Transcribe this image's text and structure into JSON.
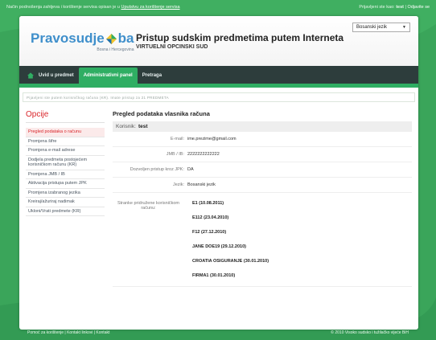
{
  "topbar": {
    "left_text": "Način podnošenja zahtjeva i korištenje servisa opisan je u",
    "left_link": "Uputstvu za korištenje servisa",
    "right_text": "Prijavljeni ste kao:",
    "right_user": "test",
    "right_sep": "|",
    "logout": "Odjavite se"
  },
  "header": {
    "logo_part1": "Pravosudje",
    "logo_part2": "ba",
    "logo_sub": "Bosna i Hercegovina",
    "title": "Pristup sudskim predmetima putem Interneta",
    "subtitle": "VIRTUELNI OPCINSKI SUD",
    "language": {
      "selected": "Bosanski jezik"
    }
  },
  "nav": {
    "tabs": [
      {
        "label": "Uvid u predmet"
      },
      {
        "label": "Administrativni panel"
      },
      {
        "label": "Pretraga"
      }
    ]
  },
  "notice": "Pijavljeni ste putem korisničkog računa (KR). Imate pristup za 21 PREDMETA",
  "sidebar": {
    "title": "Opcije",
    "items": [
      {
        "label": "Pregled podataka o računu"
      },
      {
        "label": "Promjena šifre"
      },
      {
        "label": "Promjena e-mail adrese"
      },
      {
        "label": "Dodjela predmeta postojećem korisničkom računu (KR)"
      },
      {
        "label": "Promjena JMB / IB"
      },
      {
        "label": "Aktivacija pristupa putem JPK"
      },
      {
        "label": "Promjena izabranog jezika"
      },
      {
        "label": "Kreiraj/ažuriraj nadimak"
      },
      {
        "label": "Ukloni/Vrati predmete (KR)"
      }
    ]
  },
  "content": {
    "title": "Pregled podataka vlasnika računa",
    "user_label": "Korisnik:",
    "user_value": "test",
    "fields": [
      {
        "label": "E-mail:",
        "value": "ime.prezime@gmail.com"
      },
      {
        "label": "JMB / IB:",
        "value": "2222222222222"
      },
      {
        "label": "Dozvoljen pristup kroz JPK:",
        "value": "DA"
      },
      {
        "label": "Jezik:",
        "value": "Bosanski jezik"
      }
    ],
    "firms_label": "Stranke pridružene korisničkom računu:",
    "firms": [
      "E1 (10.08.2011)",
      "E112 (23.04.2010)",
      "F12 (27.12.2010)",
      "JANE DOE19 (29.12.2010)",
      "CROATIA OSIGURANJE (30.01.2010)",
      "FIRMA1 (30.01.2010)"
    ]
  },
  "footer": {
    "links": "Pomoć za korištenje | Kontakt linkovi | Kontakt",
    "copyright": "© 2010 Visoko sudsko i tužilačko vijeće BiH"
  },
  "colors": {
    "page_bg": "#3aa55a",
    "nav_bg": "#2d3d3c",
    "accent_green": "#2fae63",
    "accent_red": "#d9252a"
  }
}
